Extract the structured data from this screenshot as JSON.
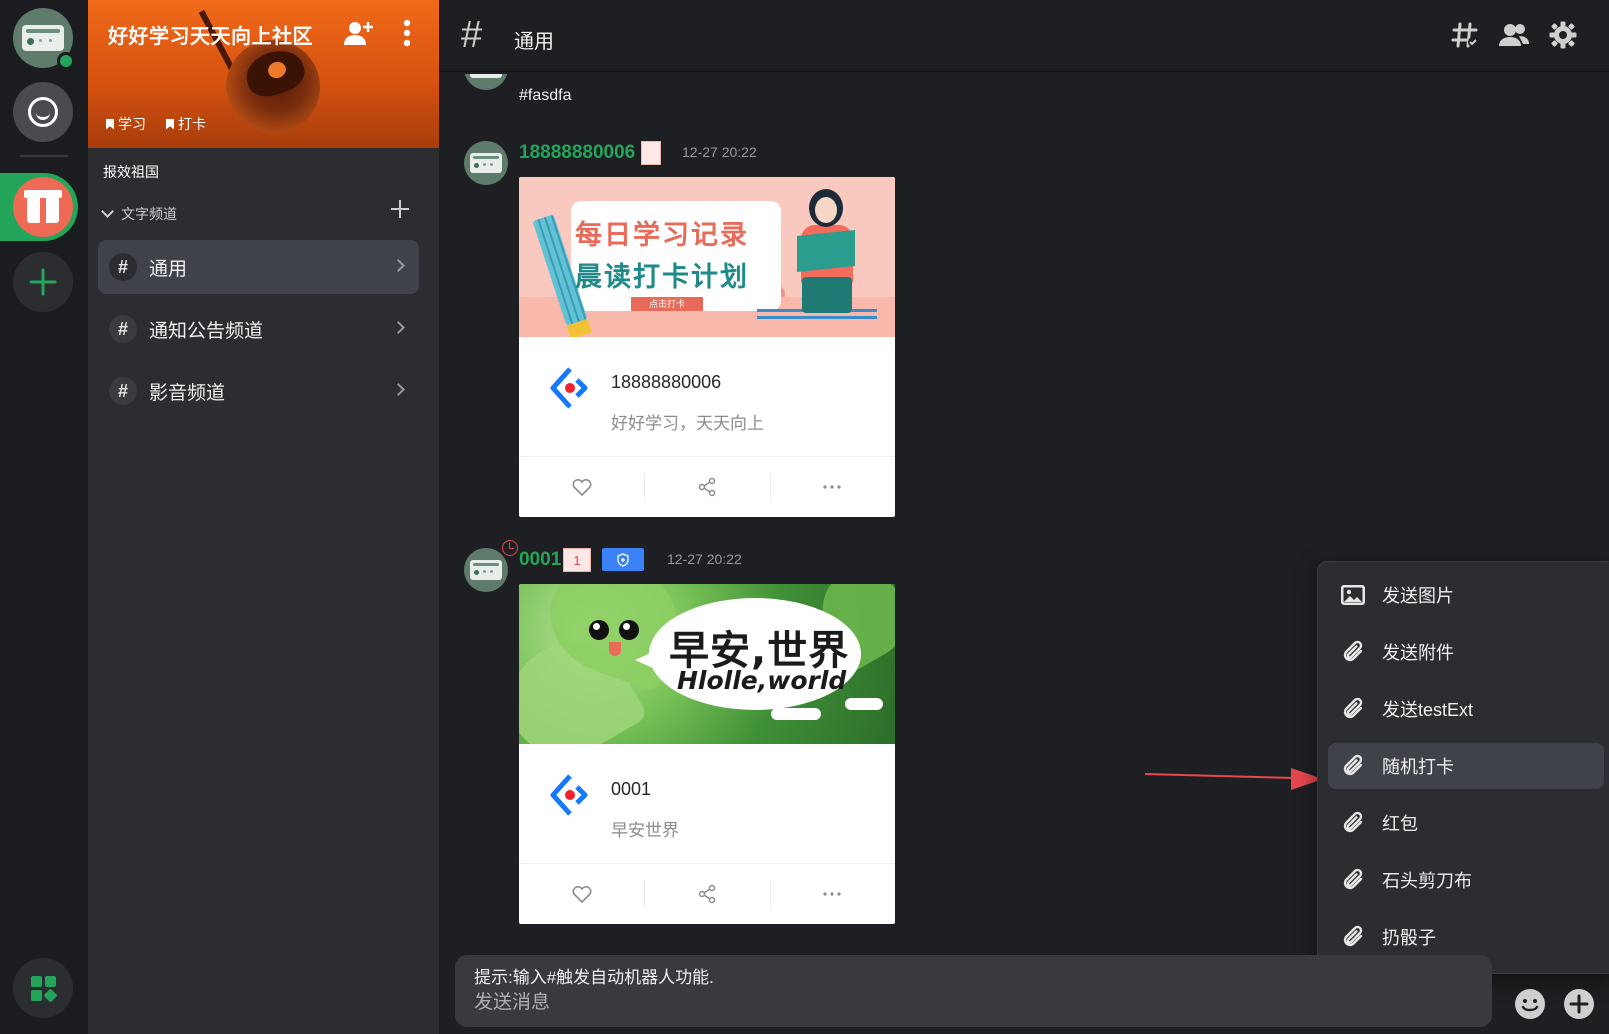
{
  "app": {
    "community_name": "好好学习天天向上社区",
    "tags": [
      "学习",
      "打卡"
    ],
    "motto": "报效祖国",
    "category_label": "文字频道"
  },
  "channels": [
    {
      "name": "通用",
      "active": true
    },
    {
      "name": "通知公告频道",
      "active": false
    },
    {
      "name": "影音频道",
      "active": false
    }
  ],
  "header": {
    "hash": "#",
    "title": "通用"
  },
  "messages": {
    "first": {
      "text": "#fasdfa"
    },
    "second": {
      "username": "18888880006",
      "time": "12-27 20:22",
      "card_line1": "每日学习记录",
      "card_line2": "晨读打卡计划",
      "card_button": "点击打卡",
      "card_title": "18888880006",
      "card_desc": "好好学习，天天向上"
    },
    "third": {
      "username": "0001",
      "badge": "1",
      "time": "12-27 20:22",
      "card_line1": "早安,世界",
      "card_line2": "Hlolle,world",
      "card_title": "0001",
      "card_desc": "早安世界"
    }
  },
  "attach_menu": [
    {
      "label": "发送图片",
      "icon": "image-icon",
      "active": false
    },
    {
      "label": "发送附件",
      "icon": "paperclip-icon",
      "active": false
    },
    {
      "label": "发送testExt",
      "icon": "paperclip-icon",
      "active": false
    },
    {
      "label": "随机打卡",
      "icon": "paperclip-icon",
      "active": true
    },
    {
      "label": "红包",
      "icon": "paperclip-icon",
      "active": false
    },
    {
      "label": "石头剪刀布",
      "icon": "paperclip-icon",
      "active": false
    },
    {
      "label": "扔骰子",
      "icon": "paperclip-icon",
      "active": false
    }
  ],
  "composer": {
    "hint": "提示:输入#触发自动机器人功能.",
    "placeholder": "发送消息"
  },
  "colors": {
    "accent_green": "#23a55a",
    "sidebar_bg": "#2b2d31",
    "main_bg": "#1e1f22",
    "banner_orange": "#f06a1a",
    "annotation_red": "#e5484d"
  }
}
